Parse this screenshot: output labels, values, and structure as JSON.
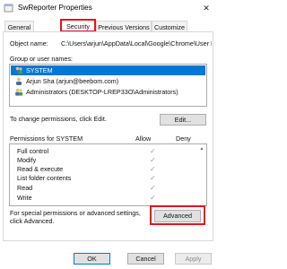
{
  "window": {
    "title": "SwReporter Properties",
    "close_glyph": "✕",
    "icon": "file-icon"
  },
  "tabs": [
    {
      "label": "General",
      "active": false
    },
    {
      "label": "Security",
      "active": true
    },
    {
      "label": "Previous Versions",
      "active": false
    },
    {
      "label": "Customize",
      "active": false
    }
  ],
  "object": {
    "label": "Object name:",
    "value": "C:\\Users\\arjun\\AppData\\Local\\Google\\Chrome\\User I"
  },
  "users": {
    "label": "Group or user names:",
    "items": [
      {
        "name": "SYSTEM",
        "selected": true,
        "icon": "group-icon"
      },
      {
        "name": "Arjun Sha (arjun@beebom.com)",
        "selected": false,
        "icon": "user-icon"
      },
      {
        "name": "Administrators (DESKTOP-LREP33O\\Administrators)",
        "selected": false,
        "icon": "group-icon"
      }
    ]
  },
  "change_hint": "To change permissions, click Edit.",
  "edit_label": "Edit...",
  "permissions": {
    "label": "Permissions for SYSTEM",
    "allow_header": "Allow",
    "deny_header": "Deny",
    "rows": [
      {
        "name": "Full control",
        "allow": true,
        "deny": false
      },
      {
        "name": "Modify",
        "allow": true,
        "deny": false
      },
      {
        "name": "Read & execute",
        "allow": true,
        "deny": false
      },
      {
        "name": "List folder contents",
        "allow": true,
        "deny": false
      },
      {
        "name": "Read",
        "allow": true,
        "deny": false
      },
      {
        "name": "Write",
        "allow": true,
        "deny": false
      }
    ]
  },
  "special": {
    "line1": "For special permissions or advanced settings,",
    "line2": "click Advanced."
  },
  "advanced_label": "Advanced",
  "footer": {
    "ok": "OK",
    "cancel": "Cancel",
    "apply": "Apply"
  },
  "colors": {
    "highlight": "#e4131e",
    "selection": "#0078d7",
    "check": "#9a9a9a"
  }
}
